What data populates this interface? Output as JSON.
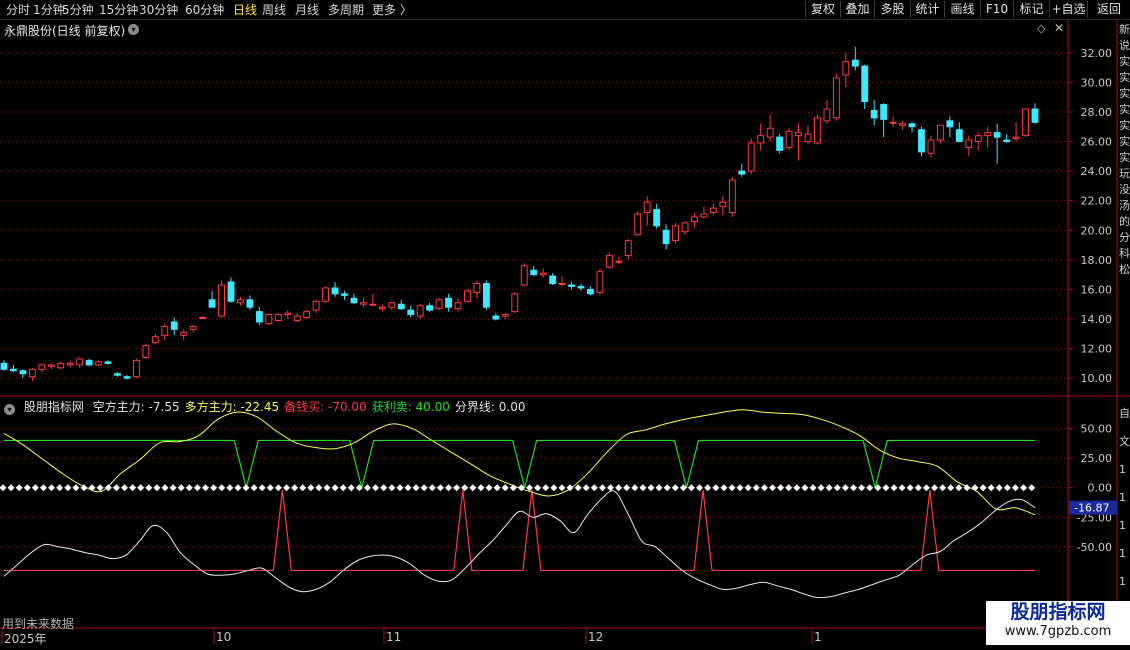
{
  "toolbar": {
    "periods": [
      "分时",
      "1分钟",
      "5分钟",
      "15分钟",
      "30分钟",
      "60分钟",
      "日线",
      "周线",
      "月线",
      "多周期",
      "更多 〉"
    ],
    "active_period": "日线",
    "right_buttons": [
      "复权",
      "叠加",
      "多股",
      "统计",
      "画线",
      "F10",
      "标记",
      "+自选",
      "返回"
    ]
  },
  "stock": {
    "title": "永鼎股份(日线 前复权)",
    "chevron": "chevron-down-icon",
    "diamond": "◇",
    "close": "✕"
  },
  "indicator": {
    "name": "股朋指标网",
    "items": [
      {
        "label": "空方主力:",
        "value": "-7.55",
        "color": "#e0e0e0"
      },
      {
        "label": "多方主力:",
        "value": "-22.45",
        "color": "#ffff55"
      },
      {
        "label": "备钱买:",
        "value": "-70.00",
        "color": "#ff3b3b"
      },
      {
        "label": "获利卖:",
        "value": "40.00",
        "color": "#22dd22"
      },
      {
        "label": "分界线:",
        "value": "0.00",
        "color": "#e0e0e0"
      }
    ]
  },
  "price_axis_labels": [
    "32.00",
    "30.00",
    "28.00",
    "26.00",
    "24.00",
    "22.00",
    "20.00",
    "18.00",
    "16.00",
    "14.00",
    "12.00",
    "10.00"
  ],
  "indicator_axis_labels": [
    "50.00",
    "25.00",
    "0.00",
    "-25.00",
    "-50.00"
  ],
  "indicator_current_value": "-16.87",
  "date_labels": [
    "2025年",
    "10",
    "11",
    "12",
    "1"
  ],
  "bottom_note": "用到未来数据",
  "brand": {
    "name": "股朋指标网",
    "url": "www.7gpzb.com"
  },
  "side_strip": [
    "新",
    "说",
    "实",
    "实",
    "实",
    "实",
    "实",
    "实",
    "实",
    "玩",
    "没",
    "汤",
    "的",
    "分",
    "科",
    "松"
  ],
  "side_strip2": [
    "自",
    "文",
    "1",
    "1",
    "1",
    "1",
    "1",
    "1"
  ],
  "colors": {
    "up": "#ff3b3b",
    "down": "#3ee8ff",
    "grid": "#8b1a1a",
    "yellow": "#ffff55",
    "green": "#22dd22",
    "white": "#e8e8e8"
  },
  "chart_data": [
    {
      "type": "candlestick",
      "title": "永鼎股份(日线 前复权)",
      "ylim": [
        9.2,
        33.0
      ],
      "ticks": [
        10,
        12,
        14,
        16,
        18,
        20,
        22,
        24,
        26,
        28,
        30,
        32
      ],
      "candles": [
        [
          11.0,
          11.2,
          10.5,
          10.6
        ],
        [
          10.6,
          10.9,
          10.4,
          10.5
        ],
        [
          10.5,
          10.6,
          10.0,
          10.3
        ],
        [
          10.1,
          10.7,
          9.8,
          10.6
        ],
        [
          10.6,
          11.0,
          10.4,
          10.9
        ],
        [
          10.8,
          11.0,
          10.6,
          10.9
        ],
        [
          10.7,
          11.1,
          10.6,
          11.0
        ],
        [
          10.9,
          11.2,
          10.7,
          11.0
        ],
        [
          10.9,
          11.4,
          10.7,
          11.3
        ],
        [
          11.2,
          11.3,
          10.8,
          10.9
        ],
        [
          10.9,
          11.2,
          10.8,
          11.1
        ],
        [
          11.1,
          11.2,
          10.9,
          11.0
        ],
        [
          10.3,
          10.4,
          10.1,
          10.2
        ],
        [
          10.1,
          10.2,
          9.9,
          10.0
        ],
        [
          10.1,
          11.3,
          10.0,
          11.2
        ],
        [
          11.4,
          12.3,
          11.3,
          12.2
        ],
        [
          12.4,
          13.0,
          12.3,
          12.8
        ],
        [
          12.9,
          13.7,
          12.6,
          13.5
        ],
        [
          13.8,
          14.1,
          12.9,
          13.3
        ],
        [
          12.9,
          13.3,
          12.6,
          13.1
        ],
        [
          13.3,
          13.6,
          13.1,
          13.5
        ],
        [
          14.1,
          14.2,
          14.0,
          14.1
        ],
        [
          15.3,
          15.9,
          14.8,
          14.8
        ],
        [
          14.2,
          16.6,
          14.1,
          16.3
        ],
        [
          16.5,
          16.8,
          15.1,
          15.2
        ],
        [
          15.1,
          15.5,
          14.9,
          15.3
        ],
        [
          15.3,
          15.6,
          14.6,
          14.8
        ],
        [
          14.5,
          14.8,
          13.6,
          13.8
        ],
        [
          13.7,
          14.4,
          13.6,
          14.3
        ],
        [
          13.9,
          14.4,
          13.8,
          14.3
        ],
        [
          14.3,
          14.6,
          14.0,
          14.4
        ],
        [
          13.9,
          14.4,
          13.8,
          14.2
        ],
        [
          14.1,
          14.6,
          14.0,
          14.5
        ],
        [
          14.6,
          15.3,
          14.4,
          15.2
        ],
        [
          15.2,
          16.2,
          15.1,
          16.1
        ],
        [
          16.1,
          16.5,
          15.5,
          15.7
        ],
        [
          15.7,
          15.9,
          15.3,
          15.6
        ],
        [
          15.4,
          15.7,
          15.0,
          15.1
        ],
        [
          15.0,
          15.4,
          14.8,
          15.1
        ],
        [
          15.0,
          15.7,
          14.9,
          15.0
        ],
        [
          14.7,
          15.0,
          14.5,
          14.8
        ],
        [
          14.8,
          15.2,
          14.6,
          15.1
        ],
        [
          15.0,
          15.3,
          14.6,
          14.7
        ],
        [
          14.6,
          14.9,
          14.1,
          14.3
        ],
        [
          14.2,
          15.0,
          14.0,
          14.9
        ],
        [
          14.9,
          15.1,
          14.5,
          14.6
        ],
        [
          14.7,
          15.4,
          14.6,
          15.3
        ],
        [
          15.4,
          15.7,
          14.5,
          14.8
        ],
        [
          14.7,
          15.4,
          14.5,
          15.1
        ],
        [
          15.2,
          16.0,
          15.1,
          15.9
        ],
        [
          15.8,
          16.6,
          15.4,
          16.4
        ],
        [
          16.4,
          16.6,
          14.6,
          14.8
        ],
        [
          14.2,
          14.4,
          13.9,
          14.0
        ],
        [
          14.2,
          14.4,
          14.0,
          14.3
        ],
        [
          14.5,
          15.8,
          14.4,
          15.7
        ],
        [
          16.3,
          17.8,
          16.2,
          17.6
        ],
        [
          17.3,
          17.6,
          16.9,
          17.0
        ],
        [
          17.0,
          17.4,
          16.8,
          17.1
        ],
        [
          16.9,
          17.1,
          16.3,
          16.4
        ],
        [
          16.4,
          16.9,
          16.2,
          16.4
        ],
        [
          16.3,
          16.5,
          16.0,
          16.2
        ],
        [
          16.2,
          16.4,
          15.9,
          16.1
        ],
        [
          16.0,
          16.2,
          15.6,
          15.7
        ],
        [
          15.8,
          17.4,
          15.6,
          17.2
        ],
        [
          17.5,
          18.5,
          17.4,
          18.3
        ],
        [
          17.9,
          18.2,
          17.7,
          17.9
        ],
        [
          18.3,
          19.4,
          18.0,
          19.3
        ],
        [
          19.7,
          21.3,
          19.6,
          21.1
        ],
        [
          21.2,
          22.3,
          20.3,
          21.9
        ],
        [
          21.4,
          21.8,
          20.1,
          20.3
        ],
        [
          20.0,
          20.4,
          18.7,
          19.1
        ],
        [
          19.3,
          20.5,
          19.1,
          20.3
        ],
        [
          19.9,
          20.6,
          19.7,
          20.5
        ],
        [
          20.6,
          21.2,
          20.2,
          20.9
        ],
        [
          20.9,
          21.6,
          20.8,
          21.1
        ],
        [
          21.2,
          21.8,
          21.0,
          21.5
        ],
        [
          21.6,
          22.3,
          21.0,
          21.9
        ],
        [
          21.2,
          23.6,
          20.9,
          23.4
        ],
        [
          24.0,
          24.5,
          23.6,
          23.8
        ],
        [
          24.0,
          26.2,
          23.8,
          25.9
        ],
        [
          25.9,
          27.2,
          25.4,
          26.4
        ],
        [
          26.3,
          27.8,
          26.0,
          26.9
        ],
        [
          26.3,
          26.5,
          25.2,
          25.4
        ],
        [
          25.6,
          26.9,
          25.4,
          26.7
        ],
        [
          26.4,
          27.2,
          24.7,
          26.6
        ],
        [
          26.0,
          27.1,
          25.8,
          26.5
        ],
        [
          25.9,
          27.8,
          25.8,
          27.6
        ],
        [
          27.4,
          28.8,
          27.2,
          28.2
        ],
        [
          27.6,
          30.6,
          27.4,
          30.3
        ],
        [
          30.5,
          32.0,
          29.7,
          31.4
        ],
        [
          31.5,
          32.4,
          30.8,
          31.1
        ],
        [
          31.1,
          31.2,
          28.2,
          28.7
        ],
        [
          28.1,
          28.8,
          27.1,
          27.6
        ],
        [
          28.5,
          28.6,
          26.3,
          27.5
        ],
        [
          27.3,
          27.7,
          27.0,
          27.3
        ],
        [
          27.1,
          27.4,
          26.8,
          27.2
        ],
        [
          27.2,
          27.3,
          26.6,
          27.0
        ],
        [
          26.8,
          27.0,
          25.0,
          25.3
        ],
        [
          25.2,
          26.4,
          24.9,
          26.1
        ],
        [
          26.1,
          27.1,
          25.9,
          27.1
        ],
        [
          27.4,
          27.7,
          26.3,
          27.0
        ],
        [
          26.8,
          27.3,
          26.0,
          26.0
        ],
        [
          25.6,
          26.4,
          25.0,
          26.1
        ],
        [
          26.0,
          26.6,
          25.4,
          26.4
        ],
        [
          26.4,
          27.0,
          25.6,
          26.6
        ],
        [
          26.6,
          27.2,
          24.5,
          26.3
        ],
        [
          26.1,
          26.5,
          25.9,
          26.0
        ],
        [
          26.2,
          27.3,
          26.0,
          26.3
        ],
        [
          26.4,
          28.2,
          26.3,
          28.2
        ],
        [
          28.2,
          28.6,
          27.2,
          27.3
        ]
      ]
    },
    {
      "type": "line",
      "title": "股朋指标网",
      "ylim": [
        -95,
        70
      ],
      "ticks": [
        50,
        25,
        0,
        -25,
        -50
      ],
      "series": [
        {
          "name": "空方主力",
          "color": "#e8e8e8",
          "values": [
            -75,
            -65,
            -55,
            -48,
            -50,
            -52,
            -55,
            -57,
            -60,
            -57,
            -45,
            -32,
            -38,
            -55,
            -65,
            -73,
            -74,
            -73,
            -70,
            -68,
            -76,
            -84,
            -88,
            -86,
            -80,
            -70,
            -62,
            -58,
            -57,
            -59,
            -65,
            -74,
            -79,
            -78,
            -68,
            -56,
            -45,
            -32,
            -20,
            -25,
            -22,
            -28,
            -38,
            -23,
            -10,
            -3,
            -22,
            -45,
            -50,
            -60,
            -70,
            -77,
            -82,
            -86,
            -85,
            -82,
            -80,
            -83,
            -86,
            -90,
            -93,
            -92,
            -89,
            -86,
            -82,
            -78,
            -74,
            -65,
            -57,
            -54,
            -45,
            -38,
            -30,
            -20,
            -12,
            -10,
            -17
          ]
        },
        {
          "name": "多方主力",
          "color": "#ffff55",
          "values": [
            46,
            36,
            24,
            12,
            2,
            -3,
            12,
            24,
            38,
            39,
            44,
            58,
            64,
            60,
            48,
            38,
            34,
            33,
            38,
            48,
            54,
            50,
            40,
            30,
            20,
            10,
            3,
            -3,
            -7,
            -2,
            12,
            30,
            45,
            49,
            54,
            58,
            61,
            64,
            66,
            64,
            63,
            62,
            58,
            52,
            44,
            32,
            25,
            22,
            18,
            5,
            -3,
            -18,
            -17,
            -23
          ]
        },
        {
          "name": "备钱买",
          "color": "#ff3b3b",
          "values": [
            -70,
            -70,
            -70,
            -70,
            -70,
            -70,
            -70,
            -70,
            -70,
            -70,
            -70,
            -70,
            -70,
            -70,
            -70,
            -70,
            -70,
            -70,
            -70,
            -70,
            -70,
            -70,
            -70,
            -70,
            -70,
            -70,
            -70,
            -70,
            -70,
            -70,
            -70,
            -70,
            -70,
            -70,
            -70,
            -70,
            -70,
            -70,
            -70,
            -70,
            -70,
            -70,
            -70,
            -70,
            -70,
            -70,
            -70,
            -70,
            -70,
            -70,
            -70,
            -70,
            -70,
            -70,
            -70,
            -70,
            -70,
            -70,
            -70,
            -70,
            -70,
            -70,
            -70,
            -70,
            -70,
            -70,
            -70,
            -70,
            -70,
            -70,
            -70,
            -70,
            -70,
            -70,
            -70,
            -70,
            -70
          ]
        },
        {
          "name": "获利卖",
          "color": "#22dd22",
          "values": [
            40,
            40,
            40,
            40,
            40,
            40,
            40,
            40,
            40,
            40,
            40,
            40,
            40,
            40,
            40,
            40,
            40,
            40,
            40,
            40,
            40,
            40,
            40,
            40,
            40,
            40,
            40,
            40,
            40,
            40,
            40,
            40,
            40,
            40,
            40,
            40,
            40,
            40,
            40,
            40,
            40,
            40,
            40,
            40,
            40,
            40,
            40,
            40,
            40,
            40,
            40,
            40,
            40,
            40,
            40,
            40,
            40,
            40,
            40,
            40,
            40,
            40,
            40,
            40,
            40,
            40,
            40,
            40,
            40,
            40,
            40,
            40,
            40,
            40,
            40,
            40,
            40
          ]
        },
        {
          "name": "分界线",
          "color": "#ffffff",
          "values": [
            0,
            0,
            0,
            0,
            0,
            0,
            0,
            0,
            0,
            0,
            0,
            0,
            0,
            0,
            0,
            0,
            0,
            0,
            0,
            0,
            0,
            0,
            0,
            0,
            0,
            0,
            0,
            0,
            0,
            0,
            0,
            0,
            0,
            0,
            0,
            0,
            0,
            0,
            0,
            0,
            0,
            0,
            0,
            0,
            0,
            0,
            0,
            0,
            0,
            0,
            0,
            0,
            0,
            0,
            0,
            0,
            0,
            0,
            0,
            0,
            0,
            0,
            0,
            0,
            0,
            0,
            0,
            0,
            0,
            0,
            0,
            0,
            0,
            0,
            0,
            0,
            0
          ]
        }
      ],
      "green_dips_at_fraction": [
        0.235,
        0.347,
        0.505,
        0.662,
        0.845
      ],
      "red_spikes_at_fraction": [
        0.27,
        0.445,
        0.512,
        0.678,
        0.898
      ]
    }
  ]
}
